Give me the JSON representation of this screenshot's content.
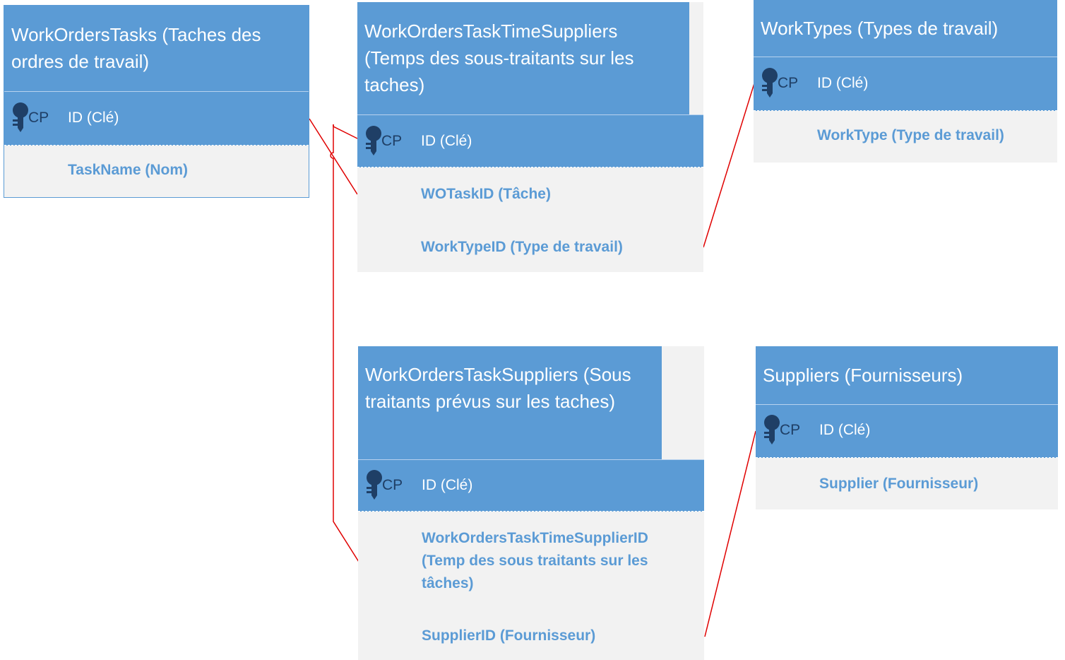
{
  "colors": {
    "header": "#5b9bd5",
    "body": "#f2f2f2",
    "field_text": "#5b9bd5",
    "key_icon": "#1f3f66",
    "link": "#e00000"
  },
  "entities": {
    "work_orders_tasks": {
      "title": "WorkOrdersTasks (Taches des ordres de travail)",
      "pk_label": "CP",
      "pk_field": "ID (Clé)",
      "fields": [
        "TaskName (Nom)"
      ]
    },
    "work_orders_task_time_suppliers": {
      "title": "WorkOrdersTaskTimeSuppliers (Temps des sous-traitants sur les taches)",
      "pk_label": "CP",
      "pk_field": "ID (Clé)",
      "fields": [
        "WOTaskID (Tâche)",
        "WorkTypeID (Type de travail)"
      ]
    },
    "work_types": {
      "title": "WorkTypes (Types de travail)",
      "pk_label": "CP",
      "pk_field": "ID (Clé)",
      "fields": [
        "WorkType (Type de travail)"
      ]
    },
    "work_orders_task_suppliers": {
      "title": "WorkOrdersTaskSuppliers (Sous traitants prévus sur les taches)",
      "pk_label": "CP",
      "pk_field": "ID (Clé)",
      "fields": [
        "WorkOrdersTaskTimeSupplierID (Temp des sous traitants sur les tâches)",
        "SupplierID (Fournisseur)"
      ]
    },
    "suppliers": {
      "title": "Suppliers (Fournisseurs)",
      "pk_label": "CP",
      "pk_field": "ID (Clé)",
      "fields": [
        "Supplier (Fournisseur)"
      ]
    }
  }
}
